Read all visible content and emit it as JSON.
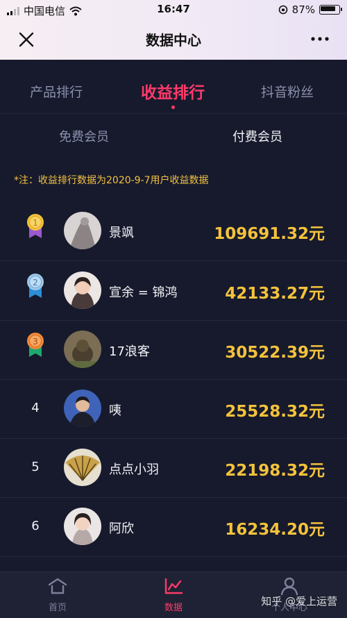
{
  "status_bar": {
    "carrier": "中国电信",
    "time": "16:47",
    "battery": "87%"
  },
  "nav": {
    "title": "数据中心"
  },
  "tabs": [
    {
      "label": "产品排行",
      "active": false
    },
    {
      "label": "收益排行",
      "active": true
    },
    {
      "label": "抖音粉丝",
      "active": false
    }
  ],
  "subtabs": [
    {
      "label": "免费会员",
      "active": false
    },
    {
      "label": "付费会员",
      "active": true
    }
  ],
  "note": "*注：收益排行数据为2020-9-7用户收益数据",
  "ranking": [
    {
      "rank": "1",
      "name": "景飒",
      "amount": "109691.32元",
      "medal": "gold"
    },
    {
      "rank": "2",
      "name": "宣余 = 锦鸿",
      "amount": "42133.27元",
      "medal": "silver"
    },
    {
      "rank": "3",
      "name": "17浪客",
      "amount": "30522.39元",
      "medal": "bronze"
    },
    {
      "rank": "4",
      "name": "咦",
      "amount": "25528.32元"
    },
    {
      "rank": "5",
      "name": "点点小羽",
      "amount": "22198.32元"
    },
    {
      "rank": "6",
      "name": "阿欣",
      "amount": "16234.20元"
    }
  ],
  "tabbar": [
    {
      "label": "首页",
      "icon": "home-icon",
      "active": false
    },
    {
      "label": "数据",
      "icon": "chart-icon",
      "active": true
    },
    {
      "label": "个人中心",
      "icon": "user-icon",
      "active": false
    }
  ],
  "watermark": "知乎 @爱上运营",
  "colors": {
    "accent": "#ff3a6a",
    "amount": "#f4c23c",
    "note": "#f2c242",
    "background": "#171a2c"
  }
}
